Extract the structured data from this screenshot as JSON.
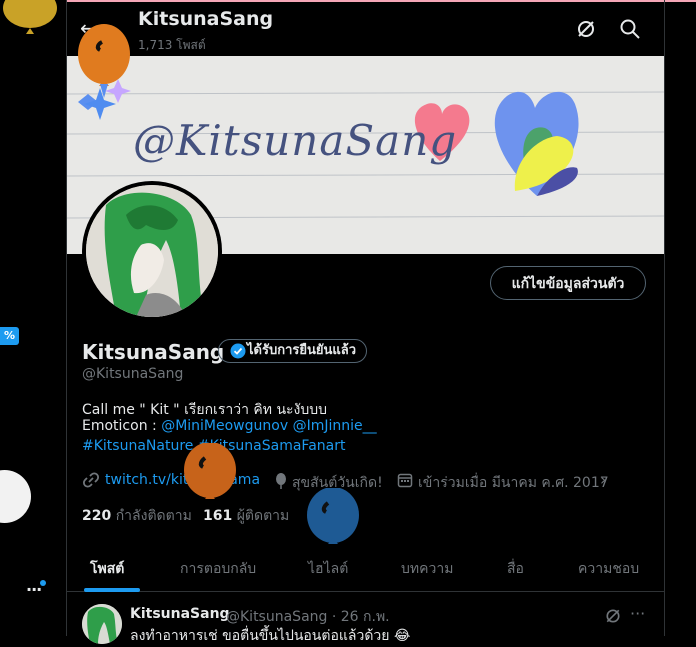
{
  "header": {
    "back_label": "←",
    "title": "KitsunaSang",
    "post_count": "1,713 โพสต์"
  },
  "banner": {
    "watermark": "@KitsunaSang"
  },
  "left_rail": {
    "badge": "%",
    "more_label": "···"
  },
  "profile": {
    "edit_button": "แก้ไขข้อมูลส่วนตัว",
    "name": "KitsunaSang",
    "verified_label": "ได้รับการยืนยันแล้ว",
    "handle": "@KitsunaSang",
    "bio_line1": "Call me \" Kit \" เรียกเราว่า คิท นะงับบบ",
    "bio_line2_prefix": "Emoticon : ",
    "bio_line2_link1": "@MiniMeowgunov",
    "bio_line2_link2": "@ImJinnie__",
    "bio_line3_tag1": "#KitsunaNature",
    "bio_line3_tag2": "#KitsunaSamaFanart",
    "website": "twitch.tv/kitsunasama",
    "birthday": "สุขสันต์วันเกิด!",
    "joined": "เข้าร่วมเมื่อ มีนาคม ค.ศ. 2017",
    "following_count": "220",
    "following_label": "กำลังติดตาม",
    "followers_count": "161",
    "followers_label": "ผู้ติดตาม"
  },
  "tabs": [
    "โพสต์",
    "การตอบกลับ",
    "ไฮไลต์",
    "บทความ",
    "สื่อ",
    "ความชอบ"
  ],
  "active_tab": "โพสต์",
  "post": {
    "name": "KitsunaSang",
    "handle": "@KitsunaSang · 26 ก.พ.",
    "text": "ลงทำอาหารเช่ ขอตื่นขึ้นไปนอนต่อแล้วด้วย 😂"
  },
  "colors": {
    "accent": "#1d9bf0",
    "muted": "#71767b",
    "text": "#e7e9ea",
    "border": "#2f3336"
  },
  "icons": [
    "back-arrow-icon",
    "grok-icon",
    "search-icon",
    "verified-badge-icon",
    "link-icon",
    "balloon-birthday-icon",
    "calendar-icon",
    "chevron-right-icon",
    "more-icon"
  ]
}
